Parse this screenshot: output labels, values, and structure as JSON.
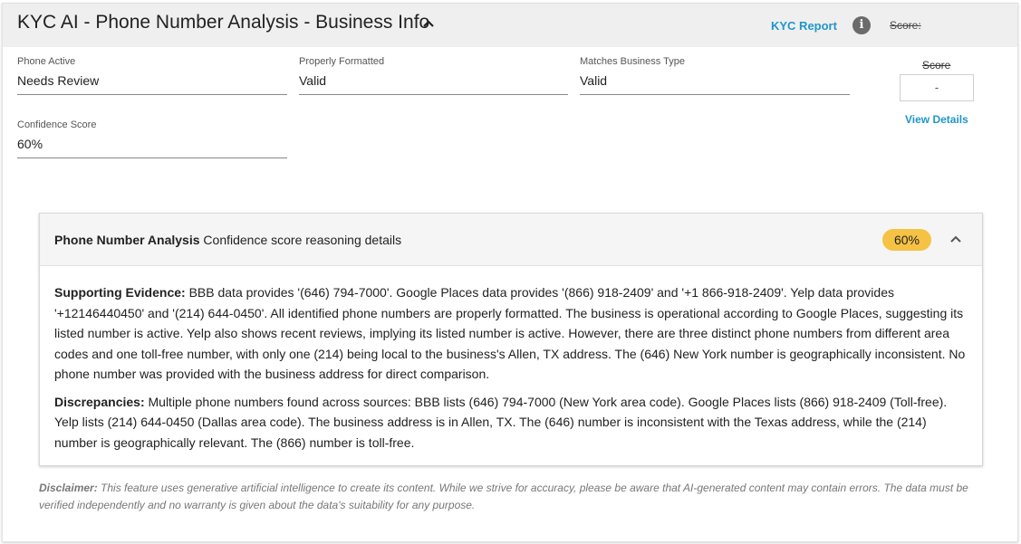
{
  "header": {
    "title": "KYC AI - Phone Number Analysis - Business Info",
    "kyc_report_label": "KYC Report",
    "info_icon": "i",
    "score_label": "Score:"
  },
  "fields": {
    "phone_active": {
      "label": "Phone Active",
      "value": "Needs Review"
    },
    "properly_formatted": {
      "label": "Properly Formatted",
      "value": "Valid"
    },
    "matches_business_type": {
      "label": "Matches Business Type",
      "value": "Valid"
    },
    "confidence_score": {
      "label": "Confidence Score",
      "value": "60%"
    }
  },
  "score_box": {
    "label": "Score",
    "value": "-",
    "view_details_label": "View Details"
  },
  "analysis_panel": {
    "title_bold": "Phone Number Analysis",
    "title_rest": " Confidence score reasoning details",
    "badge": "60%",
    "badge_color": "#f6c244",
    "supporting_label": "Supporting Evidence:",
    "supporting_text": " BBB data provides '(646) 794-7000'. Google Places data provides '(866) 918-2409' and '+1 866-918-2409'. Yelp data provides '+12146440450' and '(214) 644-0450'. All identified phone numbers are properly formatted. The business is operational according to Google Places, suggesting its listed number is active. Yelp also shows recent reviews, implying its listed number is active. However, there are three distinct phone numbers from different area codes and one toll-free number, with only one (214) being local to the business's Allen, TX address. The (646) New York number is geographically inconsistent. No phone number was provided with the business address for direct comparison.",
    "discrepancies_label": "Discrepancies:",
    "discrepancies_text": " Multiple phone numbers found across sources: BBB lists (646) 794-7000 (New York area code). Google Places lists (866) 918-2409 (Toll-free). Yelp lists (214) 644-0450 (Dallas area code). The business address is in Allen, TX. The (646) number is inconsistent with the Texas address, while the (214) number is geographically relevant. The (866) number is toll-free."
  },
  "disclaimer": {
    "label": "Disclaimer:",
    "text": " This feature uses generative artificial intelligence to create its content. While we strive for accuracy, please be aware that AI-generated content may contain errors. The data must be verified independently and no warranty is given about the data's suitability for any purpose."
  },
  "colors": {
    "accent": "#2196c9",
    "header_bg": "#efefef"
  }
}
